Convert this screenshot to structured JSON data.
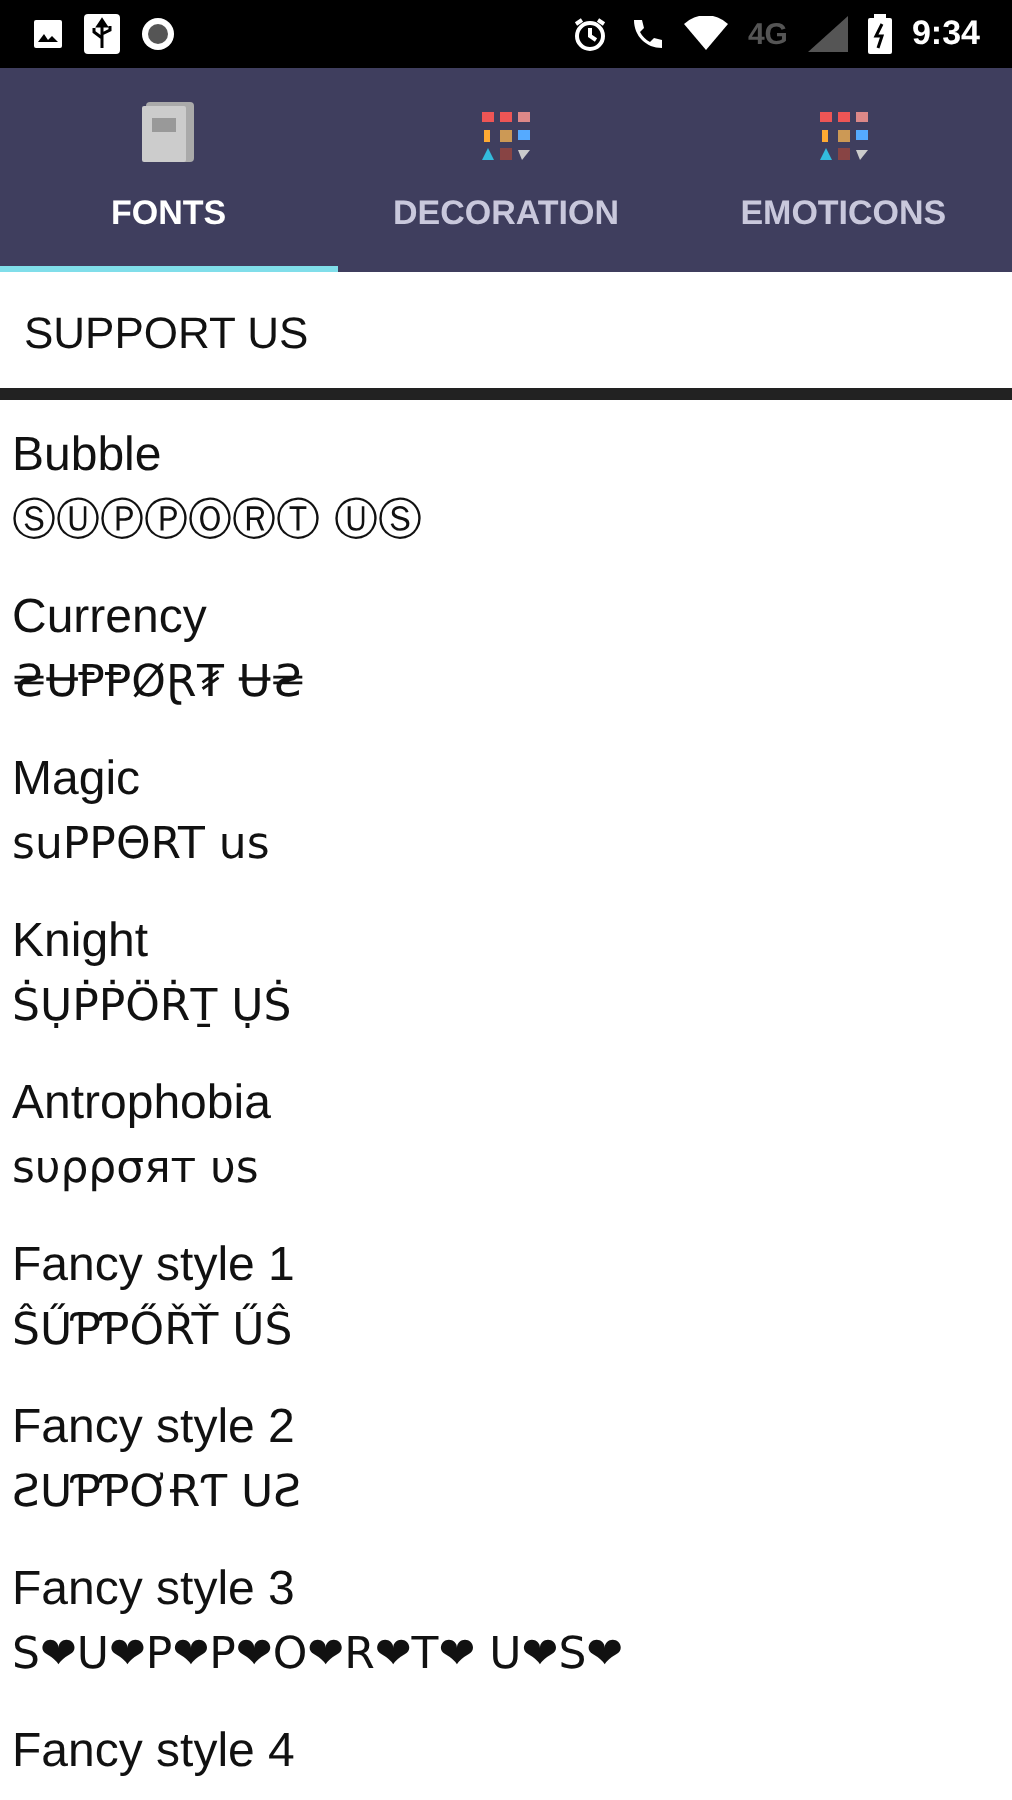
{
  "status_bar": {
    "time": "9:34",
    "network_label": "4G"
  },
  "tabs": [
    {
      "label": "FONTS",
      "selected": true,
      "kind": "book"
    },
    {
      "label": "DECORATION",
      "selected": false,
      "kind": "grid"
    },
    {
      "label": "EMOTICONS",
      "selected": false,
      "kind": "grid"
    }
  ],
  "input": {
    "value": "SUPPORT US"
  },
  "styles": [
    {
      "name": "Bubble",
      "sample": "ⓈⓊⓅⓅⓄⓇⓉ ⓊⓈ"
    },
    {
      "name": "Currency",
      "sample": "₴ɄⱣⱣØⱤ₮ Ʉ₴"
    },
    {
      "name": "Magic",
      "sample": "suPPΘRT us"
    },
    {
      "name": "Knight",
      "sample": "ṠỤṖṖÖṘṮ ỤṠ"
    },
    {
      "name": "Antrophobia",
      "sample": "ѕυρρσят υѕ"
    },
    {
      "name": "Fancy style 1",
      "sample": "ŜŰƤƤŐŘŤ ŰŜ"
    },
    {
      "name": "Fancy style 2",
      "sample": "ƧUƤƤƠɌƬ UƧ"
    },
    {
      "name": "Fancy style 3",
      "sample": "S❤U❤P❤P❤O❤R❤T❤ U❤S❤"
    },
    {
      "name": "Fancy style 4"
    }
  ]
}
